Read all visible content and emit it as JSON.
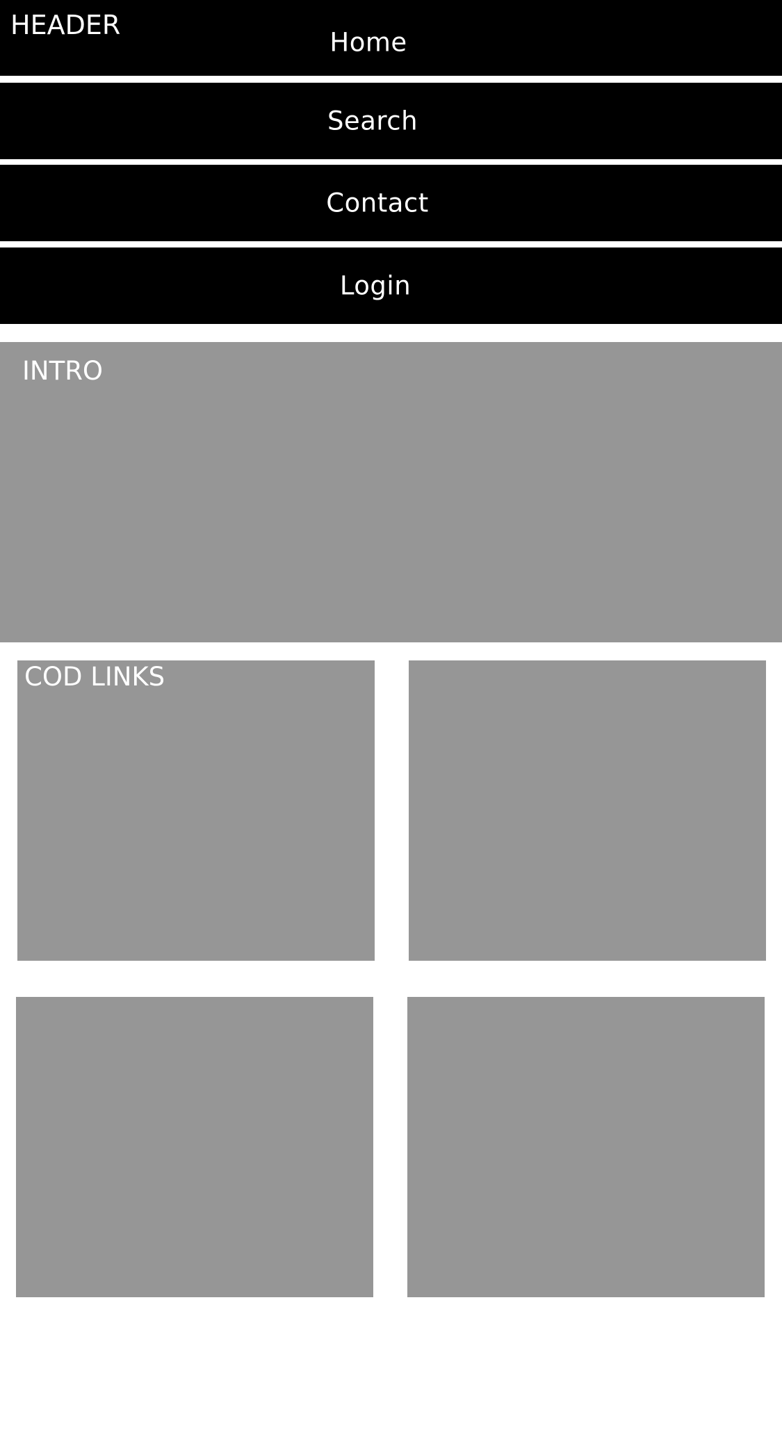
{
  "header": {
    "title": "HEADER"
  },
  "nav": {
    "home": "Home",
    "search": "Search",
    "contact": "Contact",
    "login": "Login"
  },
  "intro": {
    "label": "INTRO"
  },
  "links": {
    "label": "COD LINKS"
  },
  "colors": {
    "nav_background": "#000000",
    "block_fill": "#969696",
    "text_light": "#ffffff",
    "page_background": "#ffffff"
  }
}
